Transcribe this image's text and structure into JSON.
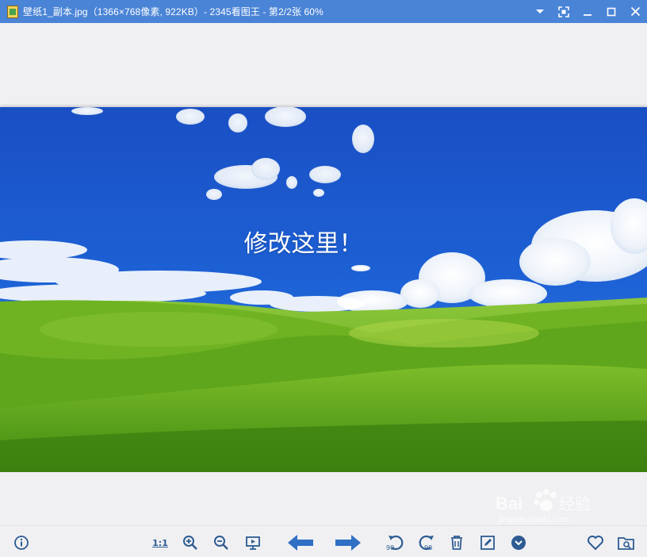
{
  "window": {
    "title": "壁纸1_副本.jpg（1366×768像素, 922KB）- 2345看图王 - 第2/2张 60%",
    "app_icon": "app-logo-icon",
    "controls": [
      "dropdown-icon",
      "fullscreen-icon",
      "minimize-icon",
      "maximize-icon",
      "close-icon"
    ]
  },
  "image": {
    "overlay_text": "修改这里！",
    "description_colors": {
      "sky": "#1c56c8",
      "grass": "#5aa81a"
    }
  },
  "watermark": {
    "brand": "Baidu经验",
    "url": "jingyan.baidu.com"
  },
  "toolbar": {
    "info": "info-icon",
    "actual_size_label": "1:1",
    "zoom_in": "zoom-in-icon",
    "zoom_out": "zoom-out-icon",
    "slideshow": "slideshow-icon",
    "prev": "arrow-left-icon",
    "next": "arrow-right-icon",
    "rotate_left_label": "90",
    "rotate_right_label": "90",
    "delete": "trash-icon",
    "edit": "edit-icon",
    "more": "chevron-down-circle-icon",
    "favorite": "heart-icon",
    "open_folder": "folder-search-icon"
  },
  "colors": {
    "titlebar": "#4a84d6",
    "toolbar_icon": "#2d5b92",
    "arrow": "#2f6fc4"
  }
}
